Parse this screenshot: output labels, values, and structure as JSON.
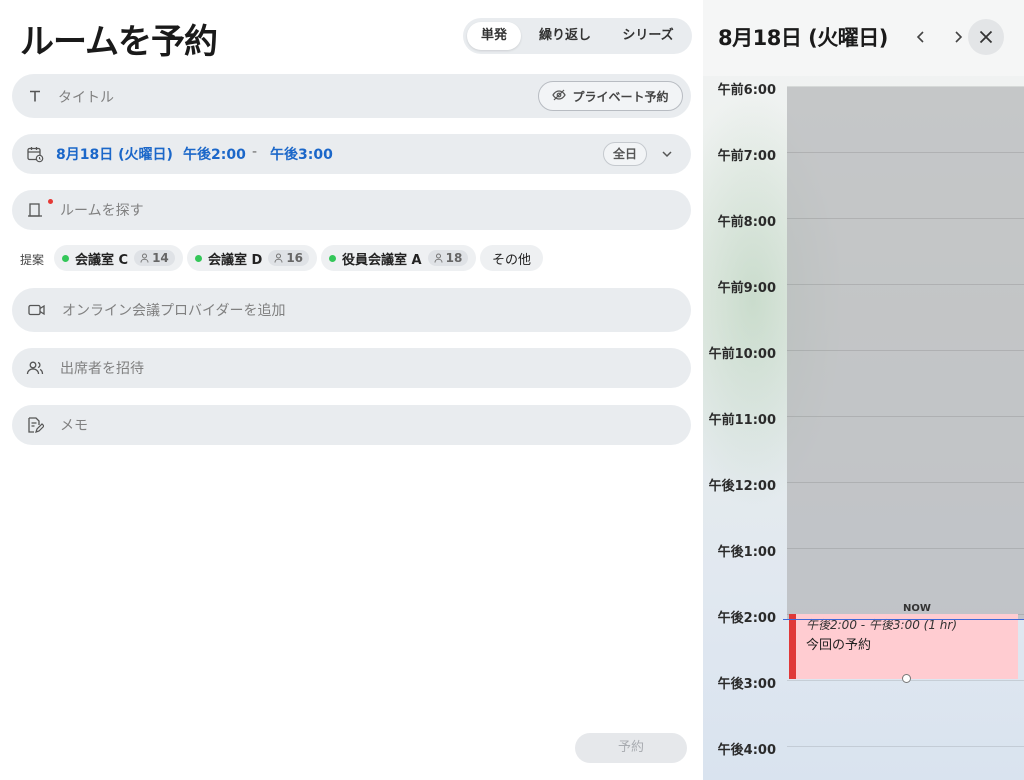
{
  "form": {
    "title": "ルームを予約",
    "modes": [
      "単発",
      "繰り返し",
      "シリーズ"
    ],
    "active_mode": "単発",
    "title_field": {
      "placeholder": "タイトル",
      "icon": "text-t-icon"
    },
    "private_button": {
      "label": "プライベート予約",
      "icon": "eye-slash-icon"
    },
    "datetime": {
      "date": "8月18日 (火曜日)",
      "start": "午後2:00",
      "separator": "-",
      "end": "午後3:00",
      "all_day_label": "全日",
      "icon": "calendar-clock-icon"
    },
    "room_field": {
      "placeholder": "ルームを探す",
      "icon": "door-icon",
      "required_color": "#e53935"
    },
    "suggestions": {
      "label": "提案",
      "items": [
        {
          "name": "会議室 C",
          "capacity": "14"
        },
        {
          "name": "会議室 D",
          "capacity": "16"
        },
        {
          "name": "役員会議室 A",
          "capacity": "18"
        }
      ],
      "more_label": "その他",
      "available_color": "#34c759"
    },
    "online_field": {
      "placeholder": "オンライン会議プロバイダーを追加",
      "icon": "video-camera-icon"
    },
    "attendees_field": {
      "placeholder": "出席者を招待",
      "icon": "people-icon"
    },
    "memo_field": {
      "placeholder": "メモ",
      "icon": "note-edit-icon"
    },
    "submit_label": "予約"
  },
  "calendar": {
    "date_header": "8月18日 (火曜日)",
    "hours": [
      "午前6:00",
      "午前7:00",
      "午前8:00",
      "午前9:00",
      "午前10:00",
      "午前11:00",
      "午後12:00",
      "午後1:00",
      "午後2:00",
      "午後3:00",
      "午後4:00"
    ],
    "now_label": "NOW",
    "now_color": "#3f68d8",
    "event": {
      "time": "午後2:00 - 午後3:00 (1 hr)",
      "title": "今回の予約",
      "accent_color": "#e03838",
      "fill_color": "#ffccd1"
    }
  }
}
